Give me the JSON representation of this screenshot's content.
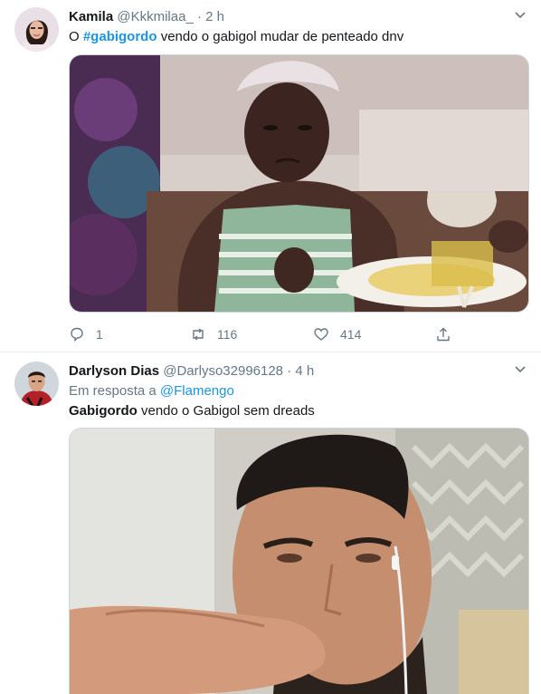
{
  "tweets": [
    {
      "name": "Kamila",
      "handle": "@Kkkmilaa_",
      "separator": "·",
      "time": "2 h",
      "text_prefix": "O",
      "hashtag": "#gabigordo",
      "text_suffix": "vendo o gabigol mudar de penteado dnv",
      "counts": {
        "reply": "1",
        "retweet": "116",
        "like": "414"
      },
      "icons": [
        "reply-icon",
        "retweet-icon",
        "like-icon",
        "share-icon",
        "chevron-down-icon"
      ]
    },
    {
      "name": "Darlyson Dias",
      "handle": "@Darlyso32996128",
      "separator": "·",
      "time": "4 h",
      "reply_prefix": "Em resposta a",
      "reply_mention": "@Flamengo",
      "text_bold": "Gabigordo",
      "text_suffix": "vendo o Gabigol sem dreads"
    }
  ],
  "colors": {
    "link": "#1b95e0",
    "muted": "#657786",
    "border": "#e6ecf0"
  }
}
